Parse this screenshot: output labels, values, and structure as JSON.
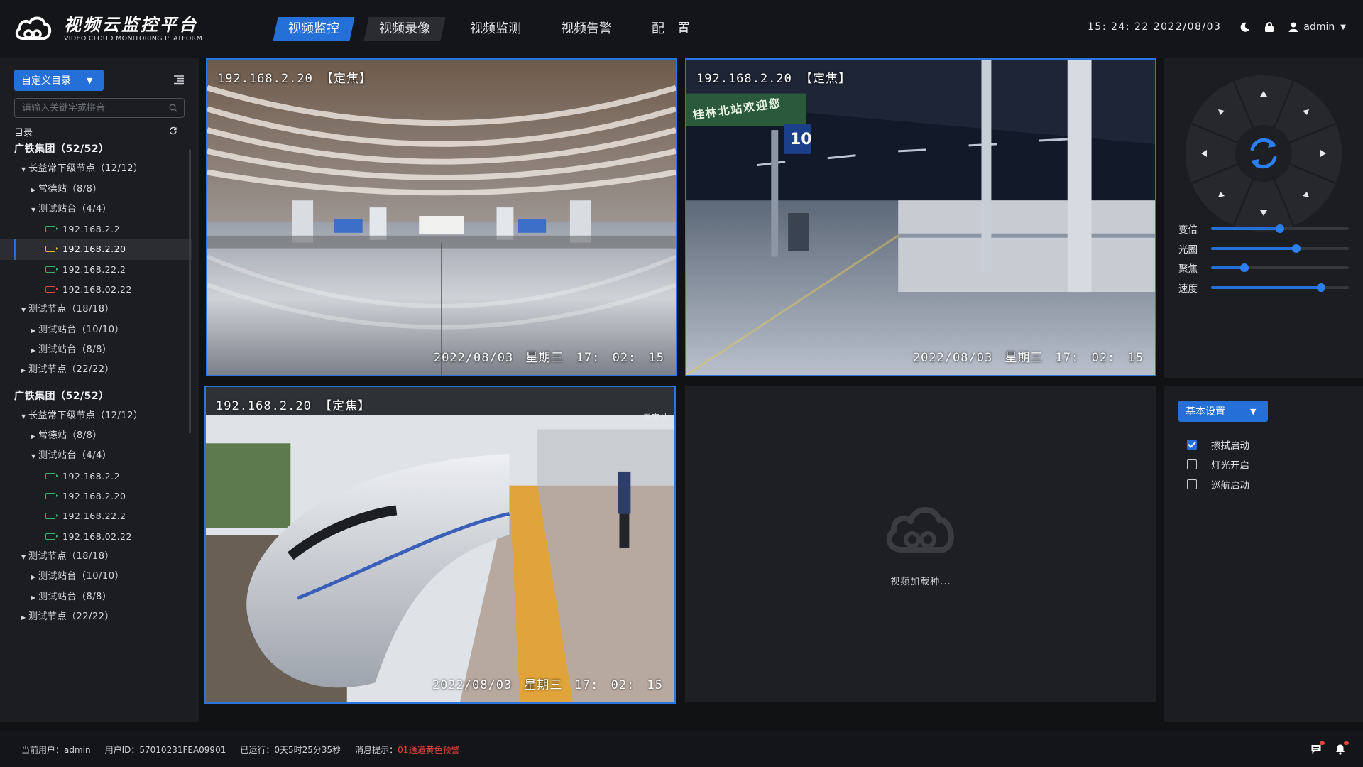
{
  "header": {
    "logo_cn": "视频云监控平台",
    "logo_en": "VIDEO CLOUD MONITORING PLATFORM",
    "nav": [
      "视频监控",
      "视频录像",
      "视频监测",
      "视频告警",
      "配　置"
    ],
    "clock": "15: 24: 22  2022/08/03",
    "user": "admin"
  },
  "sidebar": {
    "dir_button": "自定义目录",
    "search_placeholder": "请输入关键字或拼音",
    "dir_label": "目录",
    "tree": [
      {
        "level": 0,
        "text": "广铁集团（52/52）"
      },
      {
        "level": 1,
        "arrow": "▼",
        "text": "长益常下级节点（12/12）"
      },
      {
        "level": 2,
        "arrow": "▶",
        "text": "常德站（8/8）"
      },
      {
        "level": 2,
        "arrow": "▼",
        "text": "测试站台（4/4）"
      },
      {
        "level": 3,
        "cam": "green",
        "text": "192.168.2.2"
      },
      {
        "level": 3,
        "cam": "yellow",
        "text": "192.168.2.20",
        "selected": true
      },
      {
        "level": 3,
        "cam": "green",
        "text": "192.168.22.2"
      },
      {
        "level": 3,
        "cam": "red",
        "text": "192.168.02.22"
      },
      {
        "level": 1,
        "arrow": "▼",
        "text": "测试节点（18/18）"
      },
      {
        "level": 2,
        "arrow": "▶",
        "text": "测试站台（10/10）"
      },
      {
        "level": 2,
        "arrow": "▶",
        "text": "测试站台（8/8）"
      },
      {
        "level": 1,
        "arrow": "▶",
        "text": "测试节点（22/22）"
      },
      {
        "level": 0,
        "text": "广铁集团（52/52）",
        "gap": true
      },
      {
        "level": 1,
        "arrow": "▼",
        "text": "长益常下级节点（12/12）"
      },
      {
        "level": 2,
        "arrow": "▶",
        "text": "常德站（8/8）"
      },
      {
        "level": 2,
        "arrow": "▼",
        "text": "测试站台（4/4）"
      },
      {
        "level": 3,
        "cam": "green",
        "text": "192.168.2.2"
      },
      {
        "level": 3,
        "cam": "green",
        "text": "192.168.2.20"
      },
      {
        "level": 3,
        "cam": "green",
        "text": "192.168.22.2"
      },
      {
        "level": 3,
        "cam": "green",
        "text": "192.168.02.22"
      },
      {
        "level": 1,
        "arrow": "▼",
        "text": "测试节点（18/18）"
      },
      {
        "level": 2,
        "arrow": "▶",
        "text": "测试站台（10/10）"
      },
      {
        "level": 2,
        "arrow": "▶",
        "text": "测试站台（8/8）"
      },
      {
        "level": 1,
        "arrow": "▶",
        "text": "测试节点（22/22）"
      }
    ]
  },
  "tiles": [
    {
      "ip": "192.168.2.20 【定焦】",
      "time": "2022/08/03 星期三 17: 02: 15"
    },
    {
      "ip": "192.168.2.20 【定焦】",
      "time": "2022/08/03 星期三 17: 02: 15",
      "sign1": "桂林北站欢迎您",
      "sign2": "10"
    },
    {
      "ip": "192.168.2.20 【定焦】",
      "time": "2022/08/03 星期三 17: 02: 15",
      "sign1": "泰安站"
    }
  ],
  "loading_text": "视频加载种...",
  "ptz": {
    "sliders": [
      {
        "label": "变倍",
        "value": 0.5
      },
      {
        "label": "光圈",
        "value": 0.62
      },
      {
        "label": "聚焦",
        "value": 0.24
      },
      {
        "label": "速度",
        "value": 0.8
      }
    ]
  },
  "basic": {
    "button": "基本设置",
    "options": [
      {
        "label": "擦拭启动",
        "checked": true
      },
      {
        "label": "灯光开启",
        "checked": false
      },
      {
        "label": "巡航启动",
        "checked": false
      }
    ]
  },
  "status": {
    "current_user": "当前用户：admin",
    "user_id": "用户ID：57010231FEA09901",
    "uptime": "已运行：0天5时25分35秒",
    "msg_label": "消息提示：",
    "msg_value": "01通道黄色预警"
  },
  "colors": {
    "accent": "#2470d8",
    "ok": "#36b36a",
    "warn": "#e5b52a",
    "alarm": "#e04444"
  }
}
